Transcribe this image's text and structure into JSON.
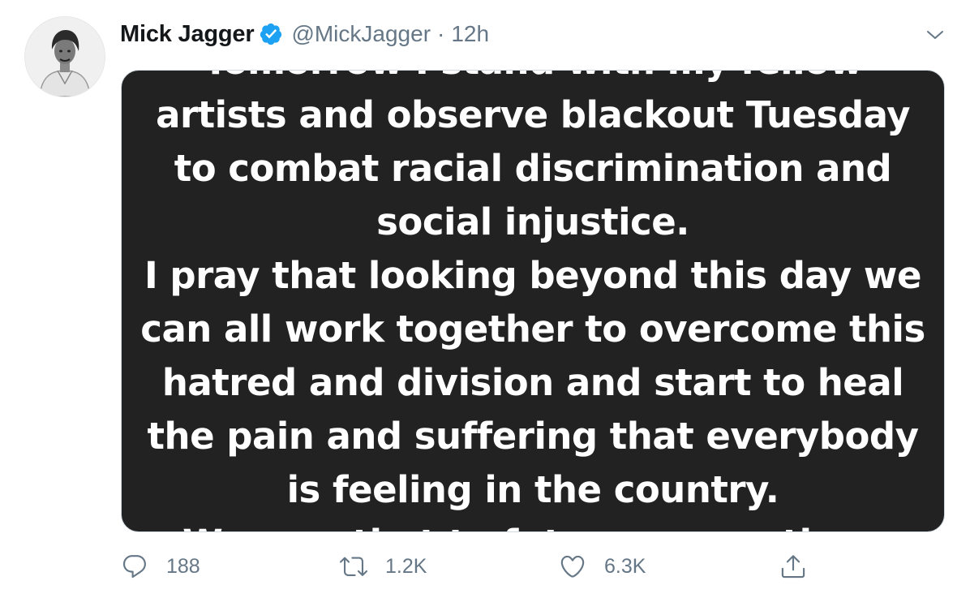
{
  "author": {
    "display_name": "Mick Jagger",
    "handle": "@MickJagger",
    "separator": "·",
    "time": "12h",
    "verified": true
  },
  "media": {
    "background": "#222222",
    "text_color": "#ffffff",
    "lines": [
      "Tomorrow I stand with my fellow",
      "artists and observe blackout Tuesday",
      "to combat racial discrimination and",
      "social injustice.",
      "I pray that looking beyond this day we",
      "can all work together to overcome this",
      "hatred and division and start to heal",
      "the pain and suffering that everybody",
      "is feeling in the country.",
      "We owe that to future generations"
    ]
  },
  "actions": {
    "reply": {
      "icon": "reply-icon",
      "count": "188"
    },
    "retweet": {
      "icon": "retweet-icon",
      "count": "1.2K"
    },
    "like": {
      "icon": "heart-icon",
      "count": "6.3K"
    },
    "share": {
      "icon": "share-icon"
    }
  },
  "colors": {
    "verified_blue": "#1da1f2",
    "secondary_text": "#657786",
    "primary_text": "#14171a"
  }
}
